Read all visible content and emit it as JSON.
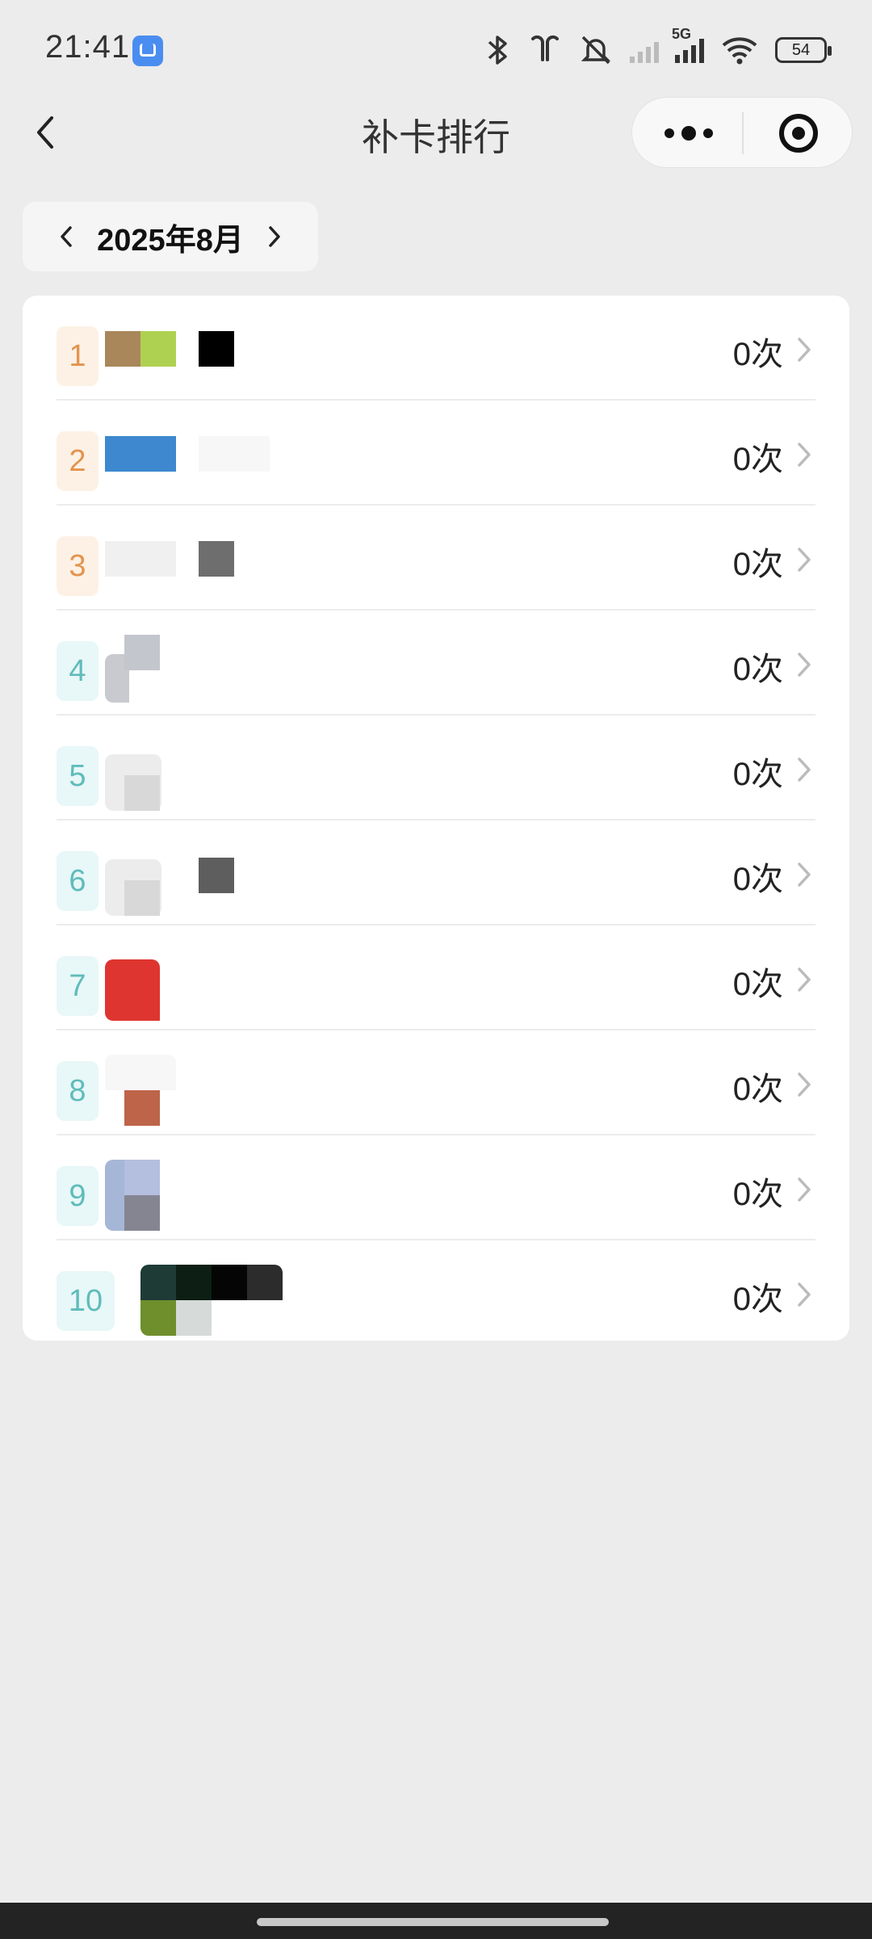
{
  "status_bar": {
    "time": "21:41",
    "network": "5G",
    "battery": "54",
    "icons": [
      "bluetooth-icon",
      "earbuds-icon",
      "mute-icon",
      "signal-icon",
      "wifi-icon",
      "battery-icon"
    ]
  },
  "nav": {
    "title": "补卡排行"
  },
  "month_picker": {
    "label": "2025年8月"
  },
  "colors": {
    "page_bg": "#ececec",
    "top_rank_bg": "#fdf1e5",
    "top_rank_text": "#e3944e",
    "rank_bg": "#e8f7f7",
    "rank_text": "#5fbcbb"
  },
  "ranking": [
    {
      "rank": "1",
      "count": "0次"
    },
    {
      "rank": "2",
      "count": "0次"
    },
    {
      "rank": "3",
      "count": "0次"
    },
    {
      "rank": "4",
      "count": "0次"
    },
    {
      "rank": "5",
      "count": "0次"
    },
    {
      "rank": "6",
      "count": "0次"
    },
    {
      "rank": "7",
      "count": "0次"
    },
    {
      "rank": "8",
      "count": "0次"
    },
    {
      "rank": "9",
      "count": "0次"
    },
    {
      "rank": "10",
      "count": "0次"
    }
  ]
}
